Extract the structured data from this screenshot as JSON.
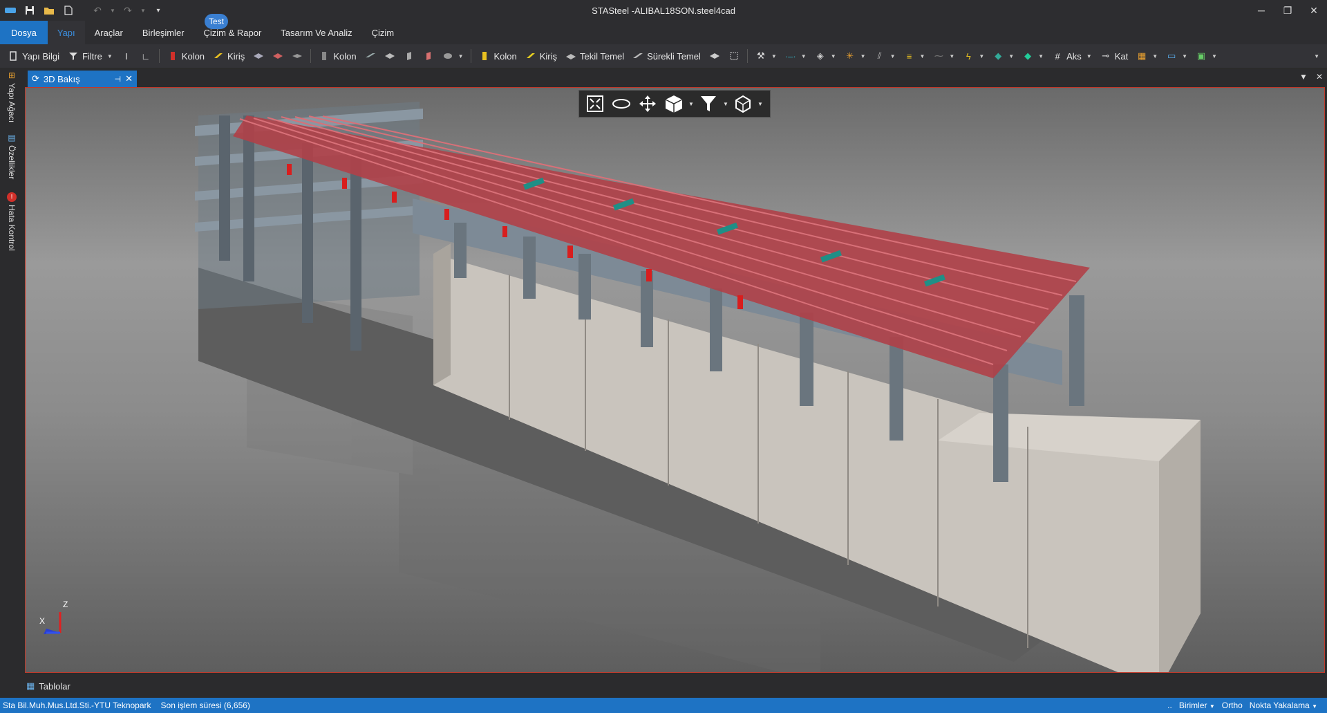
{
  "window": {
    "title": "STASteel -ALIBAL18SON.steel4cad",
    "controls": [
      "minimize",
      "restore",
      "close"
    ]
  },
  "quick_access": [
    "app-menu-icon",
    "save-icon",
    "open-folder-icon",
    "new-file-icon",
    "undo-icon",
    "redo-icon",
    "customize-icon"
  ],
  "menu": {
    "file": "Dosya",
    "items": [
      "Yapı",
      "Araçlar",
      "Birleşimler",
      "Çizim & Rapor",
      "Tasarım Ve Analiz",
      "Çizim"
    ],
    "active": "Yapı",
    "badge": "Test"
  },
  "toolbar": {
    "yapi_bilgi": "Yapı Bilgi",
    "filtre": "Filtre",
    "kolon1": "Kolon",
    "kiris1": "Kiriş",
    "kolon2": "Kolon",
    "kolon3": "Kolon",
    "kiris3": "Kiriş",
    "tekil_temel": "Tekil Temel",
    "surekli_temel": "Sürekli Temel",
    "aks": "Aks",
    "kat": "Kat"
  },
  "left_dock": {
    "tabs": [
      "Yapı Ağacı",
      "Özellikler",
      "Hata Kontrol"
    ]
  },
  "document": {
    "tab_label": "3D Bakış"
  },
  "viewport": {
    "view_tools": [
      "zoom-extents-icon",
      "orbit-icon",
      "pan-icon",
      "view-cube-icon",
      "filter-icon",
      "projection-icon"
    ],
    "axes": {
      "z": "Z",
      "x": "X"
    },
    "colors": {
      "roof": "#c0444a",
      "frame": "#7d8a96",
      "wall": "#c9c4bd",
      "column_base": "#d81e1e",
      "bracing": "#1f8f86"
    }
  },
  "bottom": {
    "tables_label": "Tablolar"
  },
  "status": {
    "company": "Sta Bil.Muh.Mus.Ltd.Sti.-YTU Teknopark",
    "last_op": "Son işlem süresi (6,656)",
    "birimler": "Birimler",
    "ortho": "Ortho",
    "snap": "Nokta Yakalama",
    "ellipsis": ".."
  }
}
